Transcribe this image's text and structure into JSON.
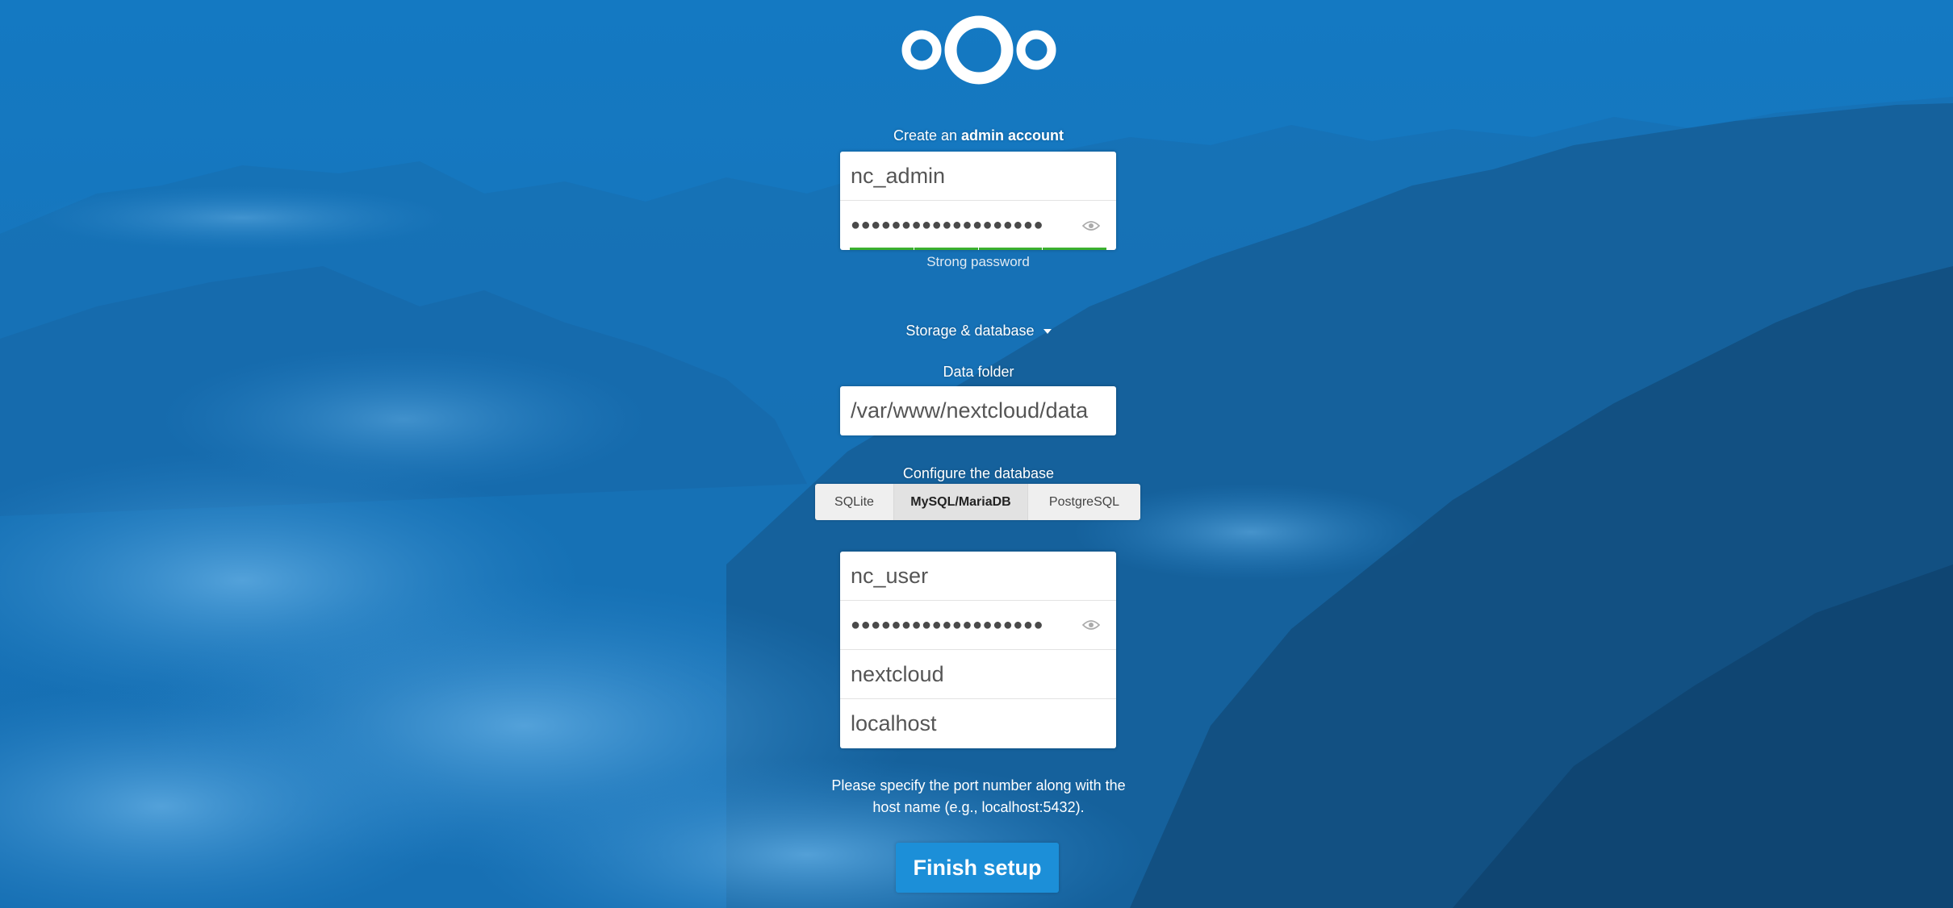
{
  "admin": {
    "heading_prefix": "Create an ",
    "heading_bold": "admin account",
    "username": "nc_admin",
    "password_mask": "●●●●●●●●●●●●●●●●●●●",
    "strength_label": "Strong password"
  },
  "storage": {
    "toggle_label": "Storage & database",
    "data_folder_label": "Data folder",
    "data_folder_value": "/var/www/nextcloud/data"
  },
  "database": {
    "configure_label": "Configure the database",
    "tabs": [
      "SQLite",
      "MySQL/MariaDB",
      "PostgreSQL"
    ],
    "selected": "MySQL/MariaDB",
    "user": "nc_user",
    "password_mask": "●●●●●●●●●●●●●●●●●●●",
    "name": "nextcloud",
    "host": "localhost",
    "hint_line1": "Please specify the port number along with the",
    "hint_line2": "host name (e.g., localhost:5432)."
  },
  "finish_label": "Finish setup",
  "colors": {
    "background": "#1279c4",
    "button": "#1c8fd8",
    "strength_bar": "#3bb02f"
  },
  "icons": {
    "logo": "nextcloud-logo",
    "password_toggle": "eye-icon",
    "dropdown": "caret-down-icon"
  }
}
